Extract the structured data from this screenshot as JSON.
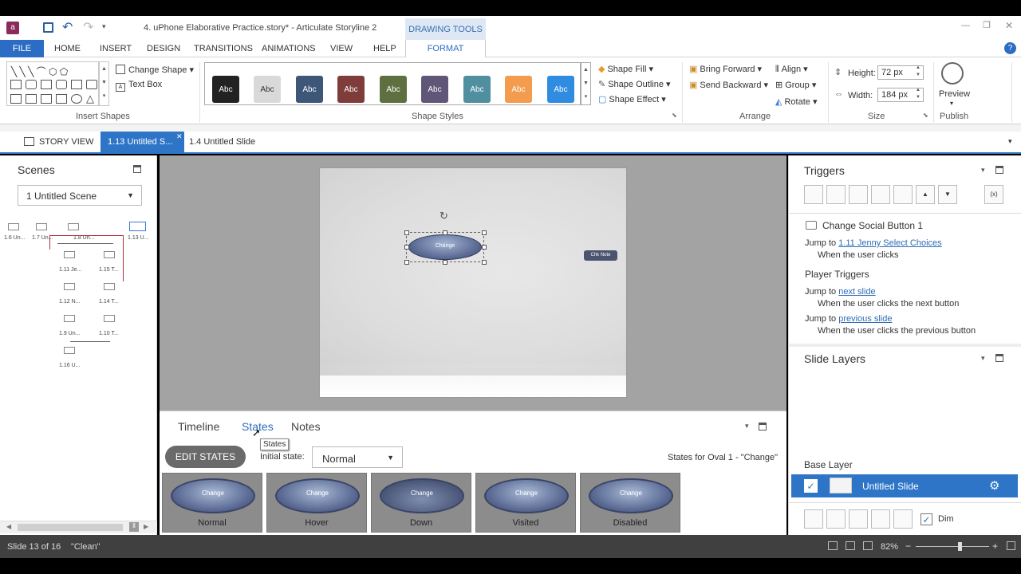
{
  "window": {
    "title": "4. uPhone Elaborative Practice.story* - Articulate Storyline 2",
    "context_tab": "DRAWING TOOLS",
    "controls": {
      "minimize": "—",
      "restore": "❐",
      "close": "✕"
    }
  },
  "ribbon_tabs": [
    "FILE",
    "HOME",
    "INSERT",
    "DESIGN",
    "TRANSITIONS",
    "ANIMATIONS",
    "VIEW",
    "HELP",
    "FORMAT"
  ],
  "ribbon": {
    "insert_shapes": {
      "label": "Insert Shapes",
      "change_shape": "Change Shape",
      "text_box": "Text Box"
    },
    "shape_styles": {
      "label": "Shape Styles",
      "swatch_text": "Abc",
      "swatches": [
        "#222222",
        "#d9d9d9",
        "#3e5678",
        "#7e3d3a",
        "#5e7040",
        "#5f5678",
        "#4f8fa0",
        "#f39c4e",
        "#2f8ce0"
      ],
      "fill": "Shape Fill",
      "outline": "Shape Outline",
      "effect": "Shape Effect"
    },
    "arrange": {
      "label": "Arrange",
      "bring_forward": "Bring Forward",
      "send_backward": "Send Backward",
      "align": "Align",
      "group": "Group",
      "rotate": "Rotate"
    },
    "size": {
      "label": "Size",
      "height_label": "Height:",
      "height_value": "72 px",
      "width_label": "Width:",
      "width_value": "184 px"
    },
    "publish": {
      "label": "Publish",
      "preview": "Preview"
    }
  },
  "doc_tabs": {
    "story_view": "STORY VIEW",
    "active": "1.13 Untitled S...",
    "other": "1.4 Untitled Slide"
  },
  "scenes": {
    "title": "Scenes",
    "dropdown": "1 Untitled Scene",
    "labels": [
      "1.6 Un...",
      "1.7 Un...",
      "1.8 Un...",
      "1.13 U...",
      "1.11 Je...",
      "1.15 T...",
      "1.12 N...",
      "1.14 T...",
      "1.9 Un...",
      "1.10 T...",
      "1.16 U..."
    ]
  },
  "stage": {
    "oval_text": "Change",
    "small_button": "Chk Note"
  },
  "bottom": {
    "tabs": [
      "Timeline",
      "States",
      "Notes"
    ],
    "tooltip": "States",
    "edit_states": "EDIT STATES",
    "initial_state_label": "Initial state:",
    "initial_state_value": "Normal",
    "states_for": "States for Oval 1 - \"Change\"",
    "state_text": "Change",
    "states": [
      "Normal",
      "Hover",
      "Down",
      "Visited",
      "Disabled"
    ]
  },
  "triggers": {
    "title": "Triggers",
    "item_title": "Change Social Button 1",
    "jump_to": "Jump to",
    "item_target": "1.11 Jenny Select Choices",
    "item_when": "When the user clicks",
    "player_title": "Player Triggers",
    "next_target": "next slide",
    "next_when": "When the user clicks the next button",
    "prev_target": "previous slide",
    "prev_when": "When the user clicks the previous button"
  },
  "layers": {
    "title": "Slide Layers",
    "base_label": "Base Layer",
    "base_slide": "Untitled Slide",
    "dim": "Dim"
  },
  "status": {
    "slide": "Slide 13 of 16",
    "theme": "\"Clean\"",
    "zoom": "82%",
    "zoom_level": 0.6
  }
}
